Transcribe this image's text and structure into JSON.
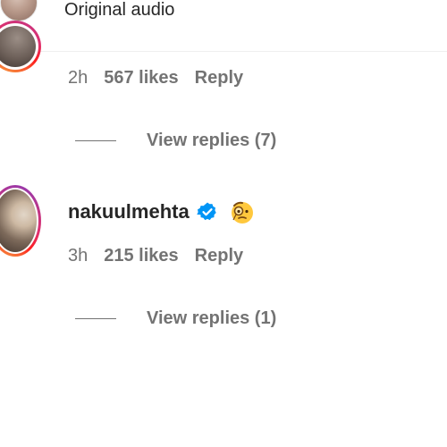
{
  "audio": {
    "label": "Original audio",
    "avatar_icon": "user-avatar"
  },
  "comments": [
    {
      "time": "2h",
      "likes": "567 likes",
      "reply_label": "Reply",
      "view_replies": "View replies (7)"
    },
    {
      "username": "nakuulmehta",
      "verified_icon": "verified-badge-icon",
      "emoji_icon": "face-with-monocle-emoji",
      "time": "3h",
      "likes": "215 likes",
      "reply_label": "Reply",
      "view_replies": "View replies (1)"
    }
  ],
  "colors": {
    "primary_text": "#262626",
    "secondary_text": "#737373",
    "verified_blue": "#0095f6",
    "emoji_yellow": "#ffc83d"
  }
}
